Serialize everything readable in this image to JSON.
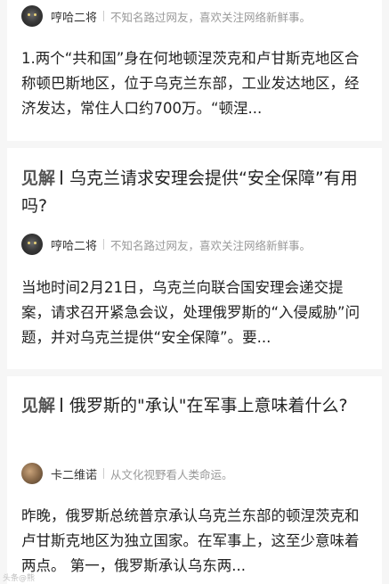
{
  "cards": [
    {
      "author": "哼哈二将",
      "bio": "不知名路过网友，喜欢关注网络新鲜事。",
      "body": "1.两个“共和国”身在何地顿涅茨克和卢甘斯克地区合称顿巴斯地区，位于乌克兰东部，工业发达地区，经济发达，常住人口约700万。“顿涅..."
    },
    {
      "tag": "见解",
      "title": "乌克兰请求安理会提供“安全保障”有用吗?",
      "author": "哼哈二将",
      "bio": "不知名路过网友，喜欢关注网络新鲜事。",
      "body": "当地时间2月21日，乌克兰向联合国安理会递交提案，请求召开紧急会议，处理俄罗斯的“入侵威胁”问题，并对乌克兰提供“安全保障”。要..."
    },
    {
      "tag": "见解",
      "title": "俄罗斯的\"承认\"在军事上意味着什么?",
      "author": "卡二维诺",
      "bio": "从文化视野看人类命运。",
      "body": "昨晚，俄罗斯总统普京承认乌克兰东部的顿涅茨克和卢甘斯克地区为独立国家。在军事上，这至少意味着两点。 第一，俄罗斯承认乌东两..."
    }
  ],
  "watermark": "头条@熊"
}
